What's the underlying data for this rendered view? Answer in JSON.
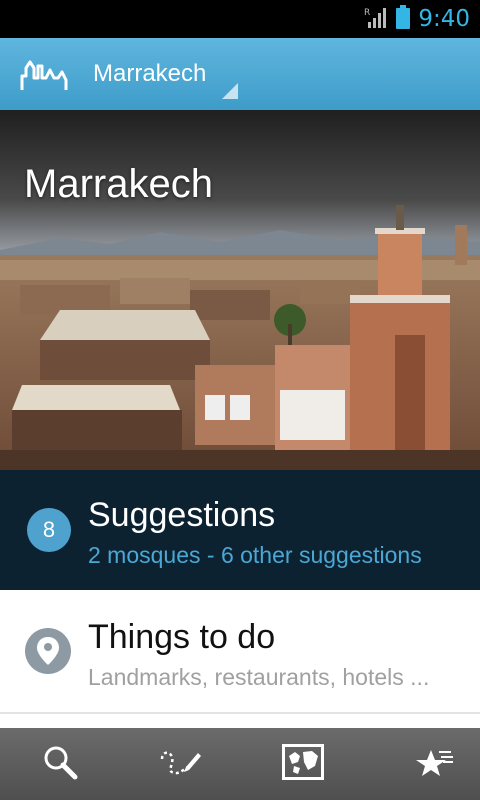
{
  "status_bar": {
    "time": "9:40",
    "signal_label": "R"
  },
  "action_bar": {
    "location": "Marrakech"
  },
  "hero": {
    "title": "Marrakech"
  },
  "suggestions": {
    "count": "8",
    "title": "Suggestions",
    "subtitle": "2 mosques - 6 other suggestions"
  },
  "things_to_do": {
    "title": "Things to do",
    "subtitle": "Landmarks, restaurants, hotels ..."
  },
  "bottom_bar": {
    "icons": [
      "search-icon",
      "itinerary-icon",
      "map-icon",
      "favorites-icon"
    ]
  },
  "colors": {
    "accent": "#33b5e5",
    "action_bar": "#4fa9d6",
    "suggestions_bg": "#0d2230",
    "badge": "#4fa2ce"
  }
}
